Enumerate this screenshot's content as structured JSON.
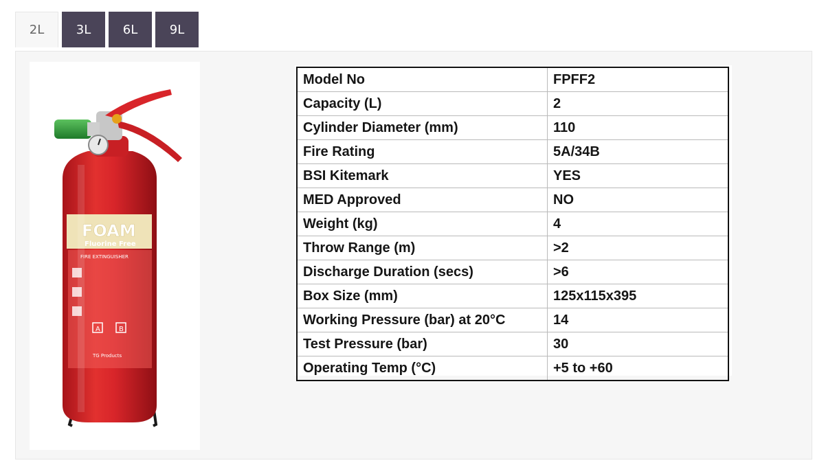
{
  "tabs": [
    {
      "label": "2L",
      "active": true
    },
    {
      "label": "3L",
      "active": false
    },
    {
      "label": "6L",
      "active": false
    },
    {
      "label": "9L",
      "active": false
    }
  ],
  "product": {
    "label_main": "FOAM",
    "label_sub": "Fluorine Free",
    "label_type": "FIRE EXTINGUISHER",
    "class_a": "A",
    "class_b": "B",
    "brand": "TG Products"
  },
  "spec_table": [
    {
      "key": "Model No",
      "value": "FPFF2"
    },
    {
      "key": "Capacity (L)",
      "value": "2"
    },
    {
      "key": "Cylinder Diameter (mm)",
      "value": "110"
    },
    {
      "key": "Fire Rating",
      "value": "5A/34B"
    },
    {
      "key": "BSI Kitemark",
      "value": "YES"
    },
    {
      "key": "MED Approved",
      "value": "NO"
    },
    {
      "key": "Weight (kg)",
      "value": "4"
    },
    {
      "key": "Throw Range (m)",
      "value": ">2"
    },
    {
      "key": "Discharge Duration (secs)",
      "value": ">6"
    },
    {
      "key": "Box Size (mm)",
      "value": "125x115x395"
    },
    {
      "key": "Working Pressure (bar) at 20°C",
      "value": "14"
    },
    {
      "key": "Test Pressure (bar)",
      "value": "30"
    },
    {
      "key": "Operating Temp (°C)",
      "value": "+5 to +60"
    }
  ],
  "colors": {
    "tab_inactive_bg": "#4a4458",
    "extinguisher_red": "#d8252a",
    "foam_band": "#efe3b8",
    "nozzle_green": "#2e9a3a"
  }
}
